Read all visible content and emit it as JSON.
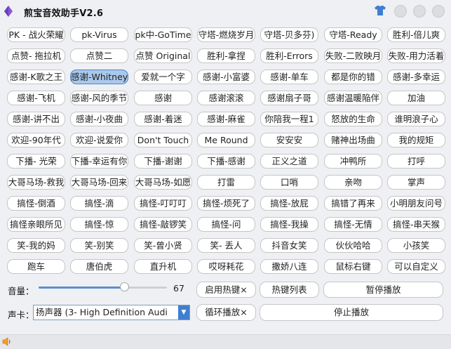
{
  "app": {
    "title": "煎宝音效助手V2.6",
    "accent_color": "#3f7fcf",
    "selected_color": "#aac8ec",
    "icons": [
      "app-logo-icon",
      "tshirt-icon",
      "speaker-icon"
    ]
  },
  "sound_buttons": [
    [
      "PK - 战火荣耀",
      "pk-Virus",
      "pk中-GoTime",
      "守塔-燃烧岁月",
      "守塔-贝多芬)",
      "守塔-Ready",
      "胜利-倍儿爽"
    ],
    [
      "点赞- 拖拉机",
      "点赞二",
      "点赞 Original",
      "胜利-拿捏",
      "胜利-Errors",
      "失败-二败映月",
      "失败-用力活着"
    ],
    [
      "感谢-K歌之王",
      "感谢-Whitney",
      "爱就一个字",
      "感谢-小富婆",
      "感谢-单车",
      "都是你的错",
      "感谢-多幸运"
    ],
    [
      "感谢-飞机",
      "感谢-风的季节",
      "感谢",
      "感谢滚滚",
      "感谢扇子哥",
      "感谢温暖陥伴",
      "加油"
    ],
    [
      "感谢-讲不出",
      "感谢-小夜曲",
      "感谢-着迷",
      "感谢-麻雀",
      "你陪我一程1",
      "怒放的生命",
      "谁明浪子心"
    ],
    [
      "欢迎-90年代",
      "欢迎-说爱你",
      "Don't Touch",
      "Me Round",
      "安安安",
      "赌神出场曲",
      "我的规矩"
    ],
    [
      "下播- 光荣",
      "下播-幸运有你",
      "下播-谢谢",
      "下播-感谢",
      "正义之道",
      "冲鸭所",
      "打呼"
    ],
    [
      "大哥马场-救我",
      "大哥马场-回来",
      "大哥马场-如愿",
      "打雷",
      "口哨",
      "亲吻",
      "掌声"
    ],
    [
      "搞怪-倒酒",
      "搞怪-滴",
      "搞怪-叮叮叮",
      "搞怪-烦死了",
      "搞怪-放屁",
      "搞错了再来",
      "小明朋友问号"
    ],
    [
      "搞怪亲眼所见",
      "搞怪-惊",
      "搞怪-敲锣笑",
      "搞怪-问",
      "搞怪-我操",
      "搞怪-无情",
      "搞怪-串天猴"
    ],
    [
      "笑-我的妈",
      "笑-别笑",
      "笑-曾小贤",
      "笑- 丢人",
      "抖音女笑",
      "伙伙哈哈",
      "小孩笑"
    ],
    [
      "跑车",
      "唐伯虎",
      "直升机",
      "哎呀耗花",
      "撒娇八连",
      "鼠标右键",
      "可以自定义"
    ]
  ],
  "selected_button": "感谢-Whitney",
  "controls": {
    "volume_label": "音量：",
    "volume_value": "67",
    "volume_fraction": 0.67,
    "hotkey_toggle": "启用热键×",
    "hotkey_list": "热键列表",
    "pause": "暂停播放",
    "sound_card_label": "声卡：",
    "sound_card_value": "扬声器 (3- High Definition Audi",
    "loop_toggle": "循环播放×",
    "stop": "停止播放"
  }
}
